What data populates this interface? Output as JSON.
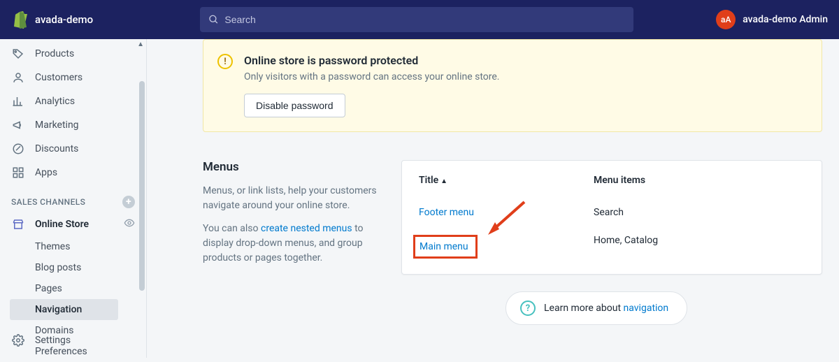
{
  "header": {
    "shop_name": "avada-demo",
    "search_placeholder": "Search",
    "avatar_initials": "aA",
    "account_name": "avada-demo Admin"
  },
  "sidebar": {
    "items_top": [
      {
        "label": "Products",
        "icon": "tag"
      },
      {
        "label": "Customers",
        "icon": "person"
      },
      {
        "label": "Analytics",
        "icon": "bars"
      },
      {
        "label": "Marketing",
        "icon": "megaphone"
      },
      {
        "label": "Discounts",
        "icon": "badge"
      },
      {
        "label": "Apps",
        "icon": "grid"
      }
    ],
    "section_title": "SALES CHANNELS",
    "online_store": "Online Store",
    "sub_items": [
      {
        "label": "Themes"
      },
      {
        "label": "Blog posts"
      },
      {
        "label": "Pages"
      },
      {
        "label": "Navigation",
        "active": true
      },
      {
        "label": "Domains"
      },
      {
        "label": "Preferences"
      }
    ],
    "settings": "Settings"
  },
  "alert": {
    "title": "Online store is password protected",
    "body": "Only visitors with a password can access your online store.",
    "button": "Disable password"
  },
  "menus": {
    "heading": "Menus",
    "p1": "Menus, or link lists, help your customers navigate around your online store.",
    "p2a": "You can also ",
    "p2_link": "create nested menus",
    "p2b": " to display drop-down menus, and group products or pages together.",
    "columns": {
      "title": "Title",
      "items": "Menu items"
    },
    "rows": [
      {
        "title": "Footer menu",
        "items": "Search"
      },
      {
        "title": "Main menu",
        "items": "Home, Catalog",
        "highlight": true
      }
    ]
  },
  "learn": {
    "prefix": "Learn more about ",
    "link": "navigation"
  }
}
